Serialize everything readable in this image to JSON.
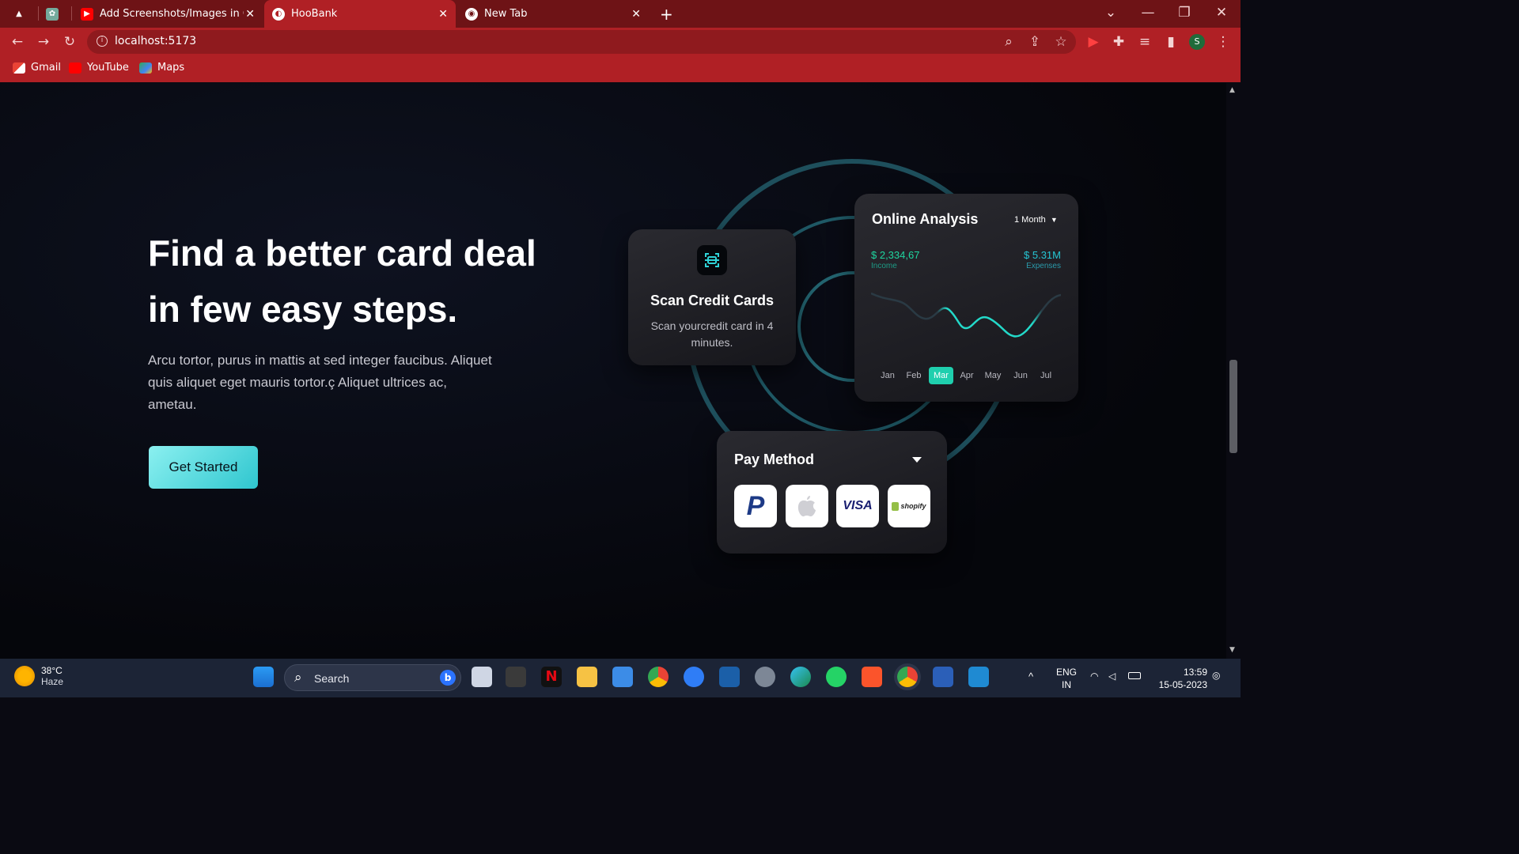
{
  "browser": {
    "tabs": [
      {
        "title": "",
        "favicon": "pin-icon"
      },
      {
        "title": "",
        "favicon": "openai-icon"
      },
      {
        "title": "Add Screenshots/Images in Githu",
        "favicon": "youtube-icon"
      },
      {
        "title": "HooBank",
        "favicon": "hoobank-icon",
        "active": true
      },
      {
        "title": "New Tab",
        "favicon": "chrome-icon"
      }
    ],
    "new_tab": "+",
    "url": "localhost:5173",
    "profile_initial": "S",
    "bookmarks": [
      "Gmail",
      "YouTube",
      "Maps"
    ],
    "theme_color": "#b02025"
  },
  "hero": {
    "title_line1": "Find a better card deal",
    "title_line2": "in few easy steps.",
    "description": "Arcu tortor, purus in mattis at sed integer faucibus. Aliquet quis aliquet eget mauris tortor.ç Aliquet ultrices ac, ametau.",
    "cta_label": "Get Started",
    "accent": "#33bbcf"
  },
  "scan_card": {
    "title": "Scan Credit Cards",
    "subtitle": "Scan yourcredit card in 4 minutes."
  },
  "analysis_card": {
    "title": "Online Analysis",
    "range": "1 Month",
    "income_value": "$ 2,334,67",
    "income_label": "Income",
    "expenses_value": "$ 5.31M",
    "expenses_label": "Expenses",
    "months": [
      "Jan",
      "Feb",
      "Mar",
      "Apr",
      "May",
      "Jun",
      "Jul"
    ],
    "selected_month": "Mar"
  },
  "pay_card": {
    "title": "Pay Method",
    "options": [
      {
        "name": "paypal-icon",
        "label": "P"
      },
      {
        "name": "apple-icon",
        "label": ""
      },
      {
        "name": "visa-icon",
        "label": "VISA"
      },
      {
        "name": "shopify-icon",
        "label": "shopify"
      }
    ]
  },
  "taskbar": {
    "temperature": "38°C",
    "weather": "Haze",
    "search_label": "Search",
    "language_line1": "ENG",
    "language_line2": "IN",
    "time": "13:59",
    "date": "15-05-2023"
  }
}
